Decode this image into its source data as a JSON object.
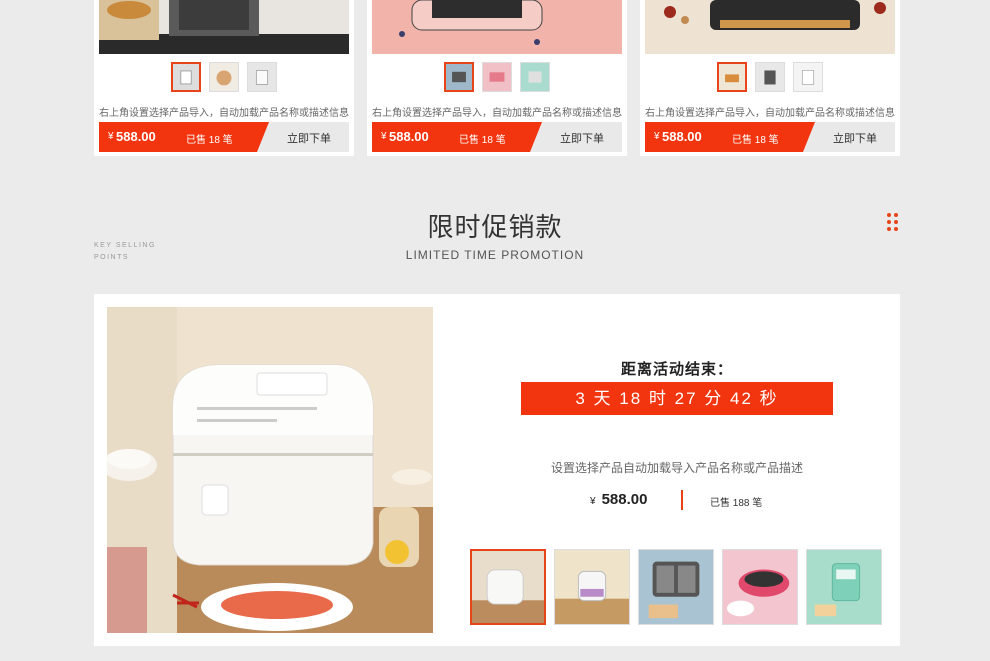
{
  "product_cards": [
    {
      "description": "右上角设置选择产品导入，自动加载产品名称或描述信息",
      "currency": "¥",
      "price": "588.00",
      "sold": "已售 18 笔",
      "buy_label": "立即下单",
      "thumbnails": [
        "kettle-white",
        "kettle-glass",
        "kettle-grey"
      ],
      "selected_thumb": 0
    },
    {
      "description": "右上角设置选择产品导入，自动加载产品名称或描述信息",
      "currency": "¥",
      "price": "588.00",
      "sold": "已售 18 笔",
      "buy_label": "立即下单",
      "thumbnails": [
        "sandwich-maker-grey",
        "sandwich-maker-pink",
        "sandwich-maker-mint"
      ],
      "selected_thumb": 0
    },
    {
      "description": "右上角设置选择产品导入，自动加载产品名称或描述信息",
      "currency": "¥",
      "price": "588.00",
      "sold": "已售 18 笔",
      "buy_label": "立即下单",
      "thumbnails": [
        "pot-orange",
        "pot-grey",
        "pot-white"
      ],
      "selected_thumb": 0
    }
  ],
  "section": {
    "title": "限时促销款",
    "subtitle": "LIMITED TIME PROMOTION",
    "key_selling_points": [
      "KEY SELLING",
      "POINTS"
    ],
    "menu_icon": "dots-grid-icon"
  },
  "promotion": {
    "countdown_label": "距离活动结束：",
    "countdown": "3 天 18 时 27 分 42 秒",
    "description": "设置选择产品自动加载导入产品名称或产品描述",
    "currency": "¥",
    "price": "588.00",
    "sold": "已售 188 笔",
    "thumbnails": [
      "rice-cooker",
      "folding-kettle",
      "sandwich-maker",
      "electric-hotpot",
      "mint-appliance"
    ],
    "selected_thumb": 0
  },
  "colors": {
    "accent": "#f2350e",
    "background": "#ebebeb"
  }
}
